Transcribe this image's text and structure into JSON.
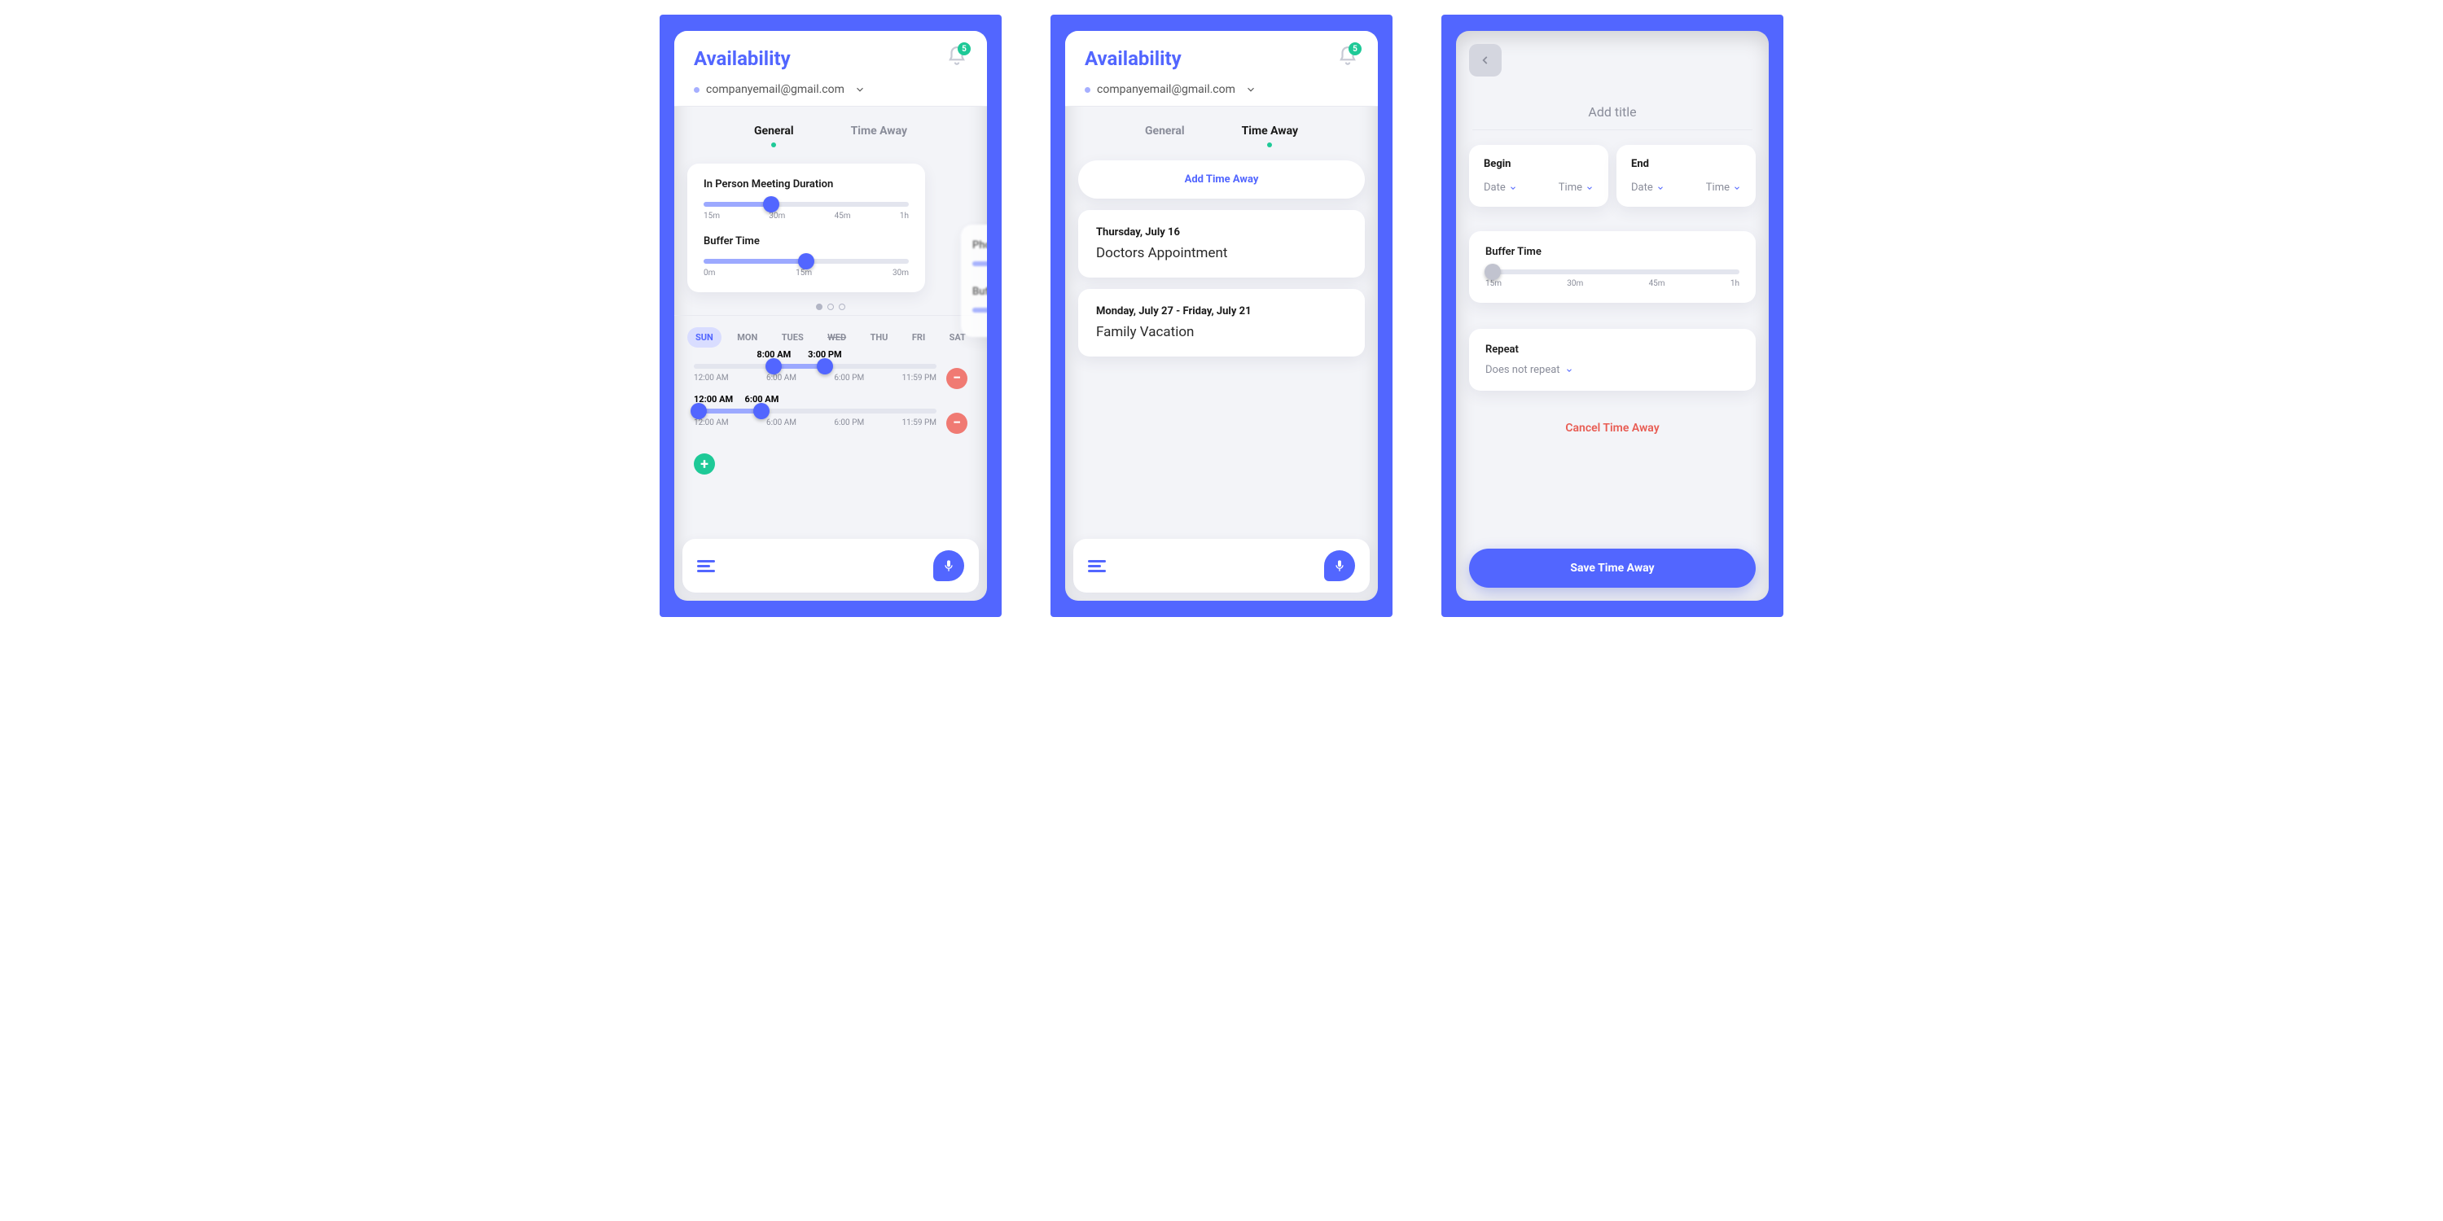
{
  "header": {
    "title": "Availability",
    "email": "companyemail@gmail.com",
    "notification_count": "5"
  },
  "tabs": {
    "general": "General",
    "time_away": "Time Away"
  },
  "screen1": {
    "card1_title": "In Person Meeting Duration",
    "card1_ticks": [
      "15m",
      "30m",
      "45m",
      "1h"
    ],
    "buffer_title": "Buffer Time",
    "buffer_ticks": [
      "0m",
      "15m",
      "30m"
    ],
    "peek1": "Pho",
    "peek2": "Buff",
    "days": [
      "SUN",
      "MON",
      "TUES",
      "WED",
      "THU",
      "FRI",
      "SAT"
    ],
    "range1": {
      "start": "8:00 AM",
      "end": "3:00 PM"
    },
    "range2": {
      "start": "12:00 AM",
      "end": "6:00 AM"
    },
    "range_ticks": [
      "12:00 AM",
      "6:00 AM",
      "6:00 PM",
      "11:59 PM"
    ]
  },
  "screen2": {
    "add_label": "Add Time Away",
    "entries": [
      {
        "date": "Thursday, July 16",
        "title": "Doctors Appointment"
      },
      {
        "date": "Monday, July 27 - Friday,  July 21",
        "title": "Family Vacation"
      }
    ]
  },
  "screen3": {
    "title_placeholder": "Add title",
    "begin_label": "Begin",
    "end_label": "End",
    "date_label": "Date",
    "time_label": "Time",
    "buffer_title": "Buffer Time",
    "buffer_ticks": [
      "15m",
      "30m",
      "45m",
      "1h"
    ],
    "repeat_label": "Repeat",
    "repeat_value": "Does not repeat",
    "cancel_label": "Cancel Time Away",
    "save_label": "Save Time Away"
  }
}
